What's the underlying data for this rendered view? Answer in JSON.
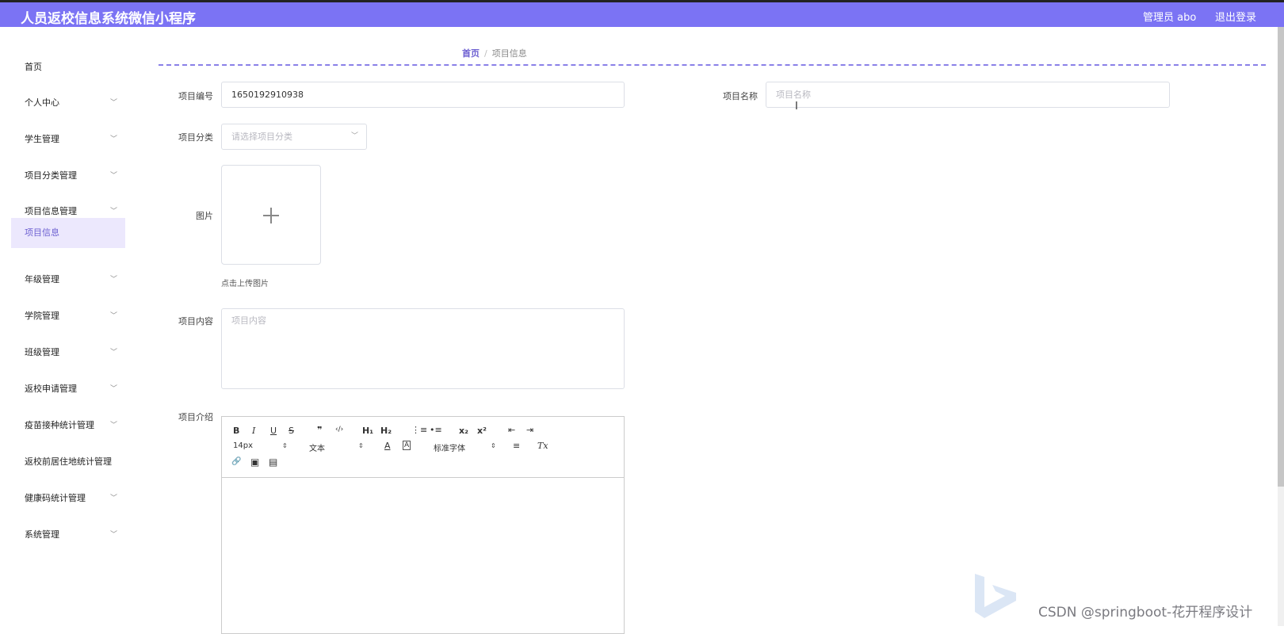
{
  "header": {
    "title": "人员返校信息系统微信小程序",
    "user": "管理员 abo",
    "logout": "退出登录"
  },
  "sidebar": {
    "items": [
      {
        "label": "首页",
        "chevron": false
      },
      {
        "label": "个人中心",
        "chevron": true
      },
      {
        "label": "学生管理",
        "chevron": true
      },
      {
        "label": "项目分类管理",
        "chevron": true
      },
      {
        "label": "项目信息管理",
        "chevron": true
      },
      {
        "label": "项目信息",
        "chevron": false,
        "active": true
      },
      {
        "label": "年级管理",
        "chevron": true
      },
      {
        "label": "学院管理",
        "chevron": true
      },
      {
        "label": "班级管理",
        "chevron": true
      },
      {
        "label": "返校申请管理",
        "chevron": true
      },
      {
        "label": "疫苗接种统计管理",
        "chevron": true
      },
      {
        "label": "返校前居住地统计管理",
        "chevron": false
      },
      {
        "label": "健康码统计管理",
        "chevron": true
      },
      {
        "label": "系统管理",
        "chevron": true
      }
    ]
  },
  "breadcrumb": {
    "home": "首页",
    "sep": "/",
    "current": "项目信息"
  },
  "form": {
    "project_no_label": "项目编号",
    "project_no_value": "1650192910938",
    "project_name_label": "项目名称",
    "project_name_placeholder": "项目名称",
    "category_label": "项目分类",
    "category_placeholder": "请选择项目分类",
    "image_label": "图片",
    "upload_hint": "点击上传图片",
    "content_label": "项目内容",
    "content_placeholder": "项目内容",
    "intro_label": "项目介绍"
  },
  "editor": {
    "bold": "B",
    "italic": "I",
    "underline": "U",
    "strike": "S",
    "quote": "❞",
    "code": "‹/›",
    "h1": "H₁",
    "h2": "H₂",
    "ol": "⋮≡",
    "ul": "•≡",
    "sub": "x₂",
    "sup": "x²",
    "outdent": "⇤",
    "indent": "⇥",
    "size": "14px",
    "header": "文本",
    "color": "A",
    "bg": "A",
    "font": "标准字体",
    "align": "≡",
    "clean": "Tx",
    "link": "🔗",
    "image": "▣",
    "video": "▤"
  },
  "watermark": "CSDN @springboot-花开程序设计"
}
